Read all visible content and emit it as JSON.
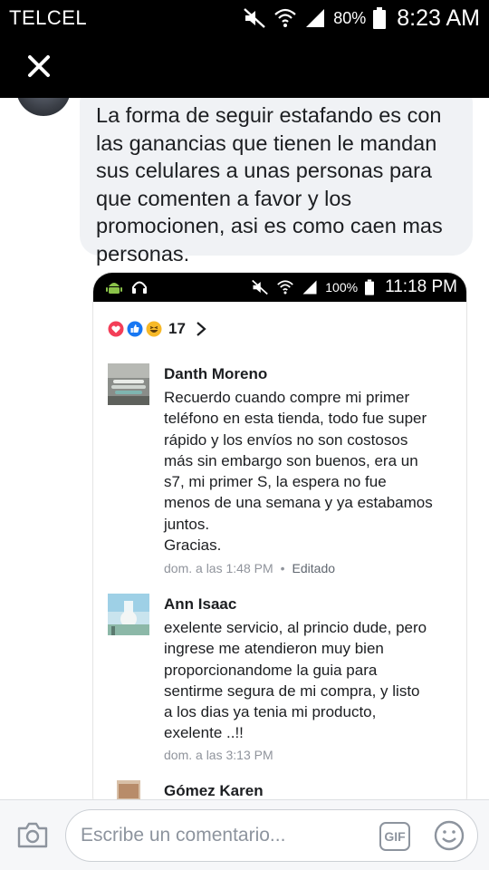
{
  "status_bar": {
    "carrier": "TELCEL",
    "battery": "80%",
    "time": "8:23 AM"
  },
  "post": {
    "comment_text": "La forma de seguir estafando es con las ganancias que tienen le mandan sus celulares a unas personas para que comenten a favor y los promocionen, asi es como caen mas personas."
  },
  "screenshot": {
    "status_bar": {
      "battery": "100%",
      "time": "11:18 PM"
    },
    "reactions_count": "17",
    "comments": [
      {
        "name": "Danth Moreno",
        "lines": [
          "Recuerdo cuando compre mi primer",
          "teléfono en esta tienda, todo fue super",
          "rápido y los envíos no son costosos",
          "más sin embargo son buenos, era un",
          "s7, mi primer S, la espera no fue",
          "menos de una semana y ya estabamos",
          "juntos.",
          "Gracias."
        ],
        "time": "dom. a las 1:48 PM",
        "edited": "Editado"
      },
      {
        "name": "Ann Isaac",
        "lines": [
          "exelente servicio, al princio dude, pero",
          "ingrese me atendieron muy bien",
          "proporcionandome la guia para",
          "sentirme segura de mi compra, y listo",
          "a los dias ya tenia mi producto,",
          "exelente ..!!"
        ],
        "time": "dom. a las 3:13 PM"
      },
      {
        "name": "Gómez Karen"
      }
    ]
  },
  "composer": {
    "placeholder": "Escribe un comentario...",
    "gif_label": "GIF"
  }
}
